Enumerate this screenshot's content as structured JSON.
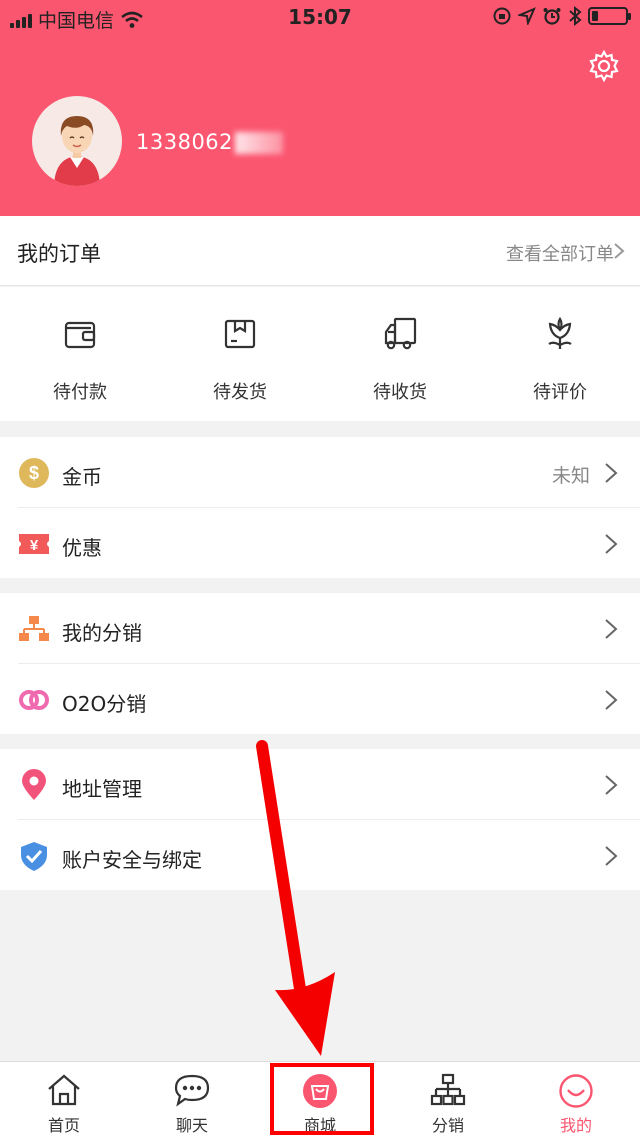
{
  "status_bar": {
    "carrier": "中国电信",
    "time": "15:07",
    "battery_level": 0.18
  },
  "profile": {
    "username": "1338062"
  },
  "orders": {
    "title": "我的订单",
    "view_all": "查看全部订单",
    "items": [
      {
        "label": "待付款",
        "icon": "wallet-icon"
      },
      {
        "label": "待发货",
        "icon": "package-icon"
      },
      {
        "label": "待收货",
        "icon": "truck-icon"
      },
      {
        "label": "待评价",
        "icon": "flower-icon"
      }
    ]
  },
  "menu": {
    "coins": {
      "label": "金币",
      "value": "未知"
    },
    "coupons": {
      "label": "优惠"
    },
    "distribution": {
      "label": "我的分销"
    },
    "o2o": {
      "label": "O2O分销"
    },
    "address": {
      "label": "地址管理"
    },
    "security": {
      "label": "账户安全与绑定"
    }
  },
  "tabbar": {
    "items": [
      {
        "label": "首页",
        "icon": "home-icon"
      },
      {
        "label": "聊天",
        "icon": "chat-icon"
      },
      {
        "label": "商城",
        "icon": "shopping-bag-icon"
      },
      {
        "label": "分销",
        "icon": "org-chart-icon"
      },
      {
        "label": "我的",
        "icon": "smile-icon"
      }
    ],
    "active_index": 4,
    "highlighted_index": 2
  },
  "colors": {
    "brand": "#fb5670",
    "highlight_box": "#ff0000",
    "coin": "#e0b85c",
    "coupon": "#f25a5a",
    "distribution": "#f5894b",
    "o2o": "#f06ab0",
    "address": "#f2537a",
    "security": "#4a90e2"
  }
}
